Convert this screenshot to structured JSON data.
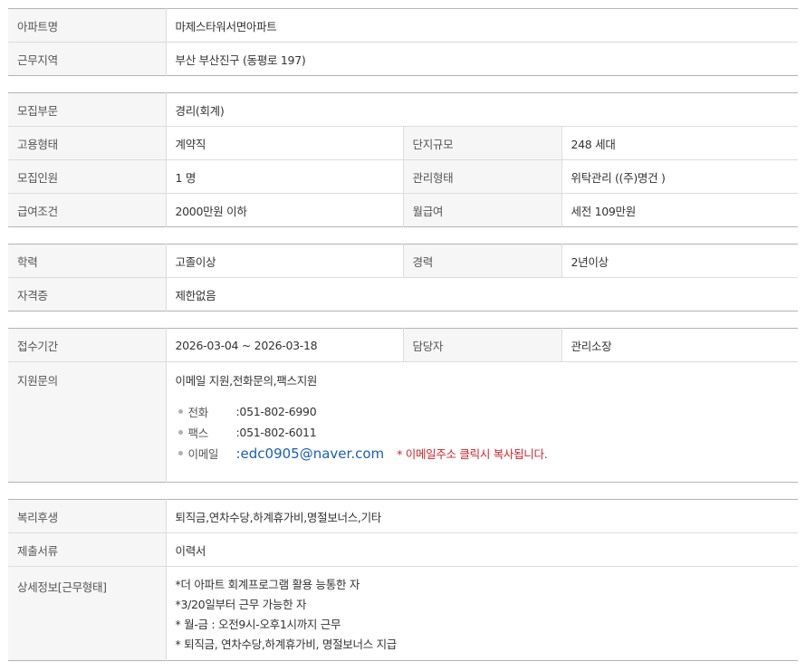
{
  "section1": {
    "apt_name_label": "아파트명",
    "apt_name": "마제스타워서면아파트",
    "region_label": "근무지역",
    "region": "부산  부산진구 (동평로 197)"
  },
  "section2": {
    "dept_label": "모집부문",
    "dept": "경리(회계)",
    "emp_type_label": "고용형태",
    "emp_type": "계약직",
    "complex_size_label": "단지규모",
    "complex_size": "248 세대",
    "headcount_label": "모집인원",
    "headcount": "1 명",
    "mgmt_type_label": "관리형태",
    "mgmt_type": "위탁관리 ((주)명건 )",
    "salary_label": "급여조건",
    "salary": "2000만원 이하",
    "monthly_label": "월급여",
    "monthly": "세전 109만원"
  },
  "section3": {
    "edu_label": "학력",
    "edu": "고졸이상",
    "career_label": "경력",
    "career": "2년이상",
    "cert_label": "자격증",
    "cert": "제한없음"
  },
  "section4": {
    "period_label": "접수기간",
    "period": "2026-03-04 ~ 2026-03-18",
    "manager_label": "담당자",
    "manager": "관리소장",
    "inquiry_label": "지원문의",
    "inquiry_lead": "이메일 지원,전화문의,팩스지원",
    "phone_label": "전화",
    "phone": ":051-802-6990",
    "fax_label": "팩스",
    "fax": ":051-802-6011",
    "email_label": "이메일",
    "email": ":edc0905@naver.com",
    "email_note": "* 이메일주소 클릭시 복사됩니다."
  },
  "section5": {
    "welfare_label": "복리후생",
    "welfare": "퇴직금,연차수당,하계휴가비,명절보너스,기타",
    "docs_label": "제출서류",
    "docs": "이력서",
    "detail_label": "상세정보[근무형태]",
    "detail_lines": [
      "*더 아파트 회계프로그램 활용 능통한 자",
      "*3/20일부터 근무 가능한 자",
      "* 월-금 : 오전9시-오후1시까지 근무",
      "* 퇴직금, 연차수당,하계휴가비, 명절보너스 지급"
    ]
  }
}
